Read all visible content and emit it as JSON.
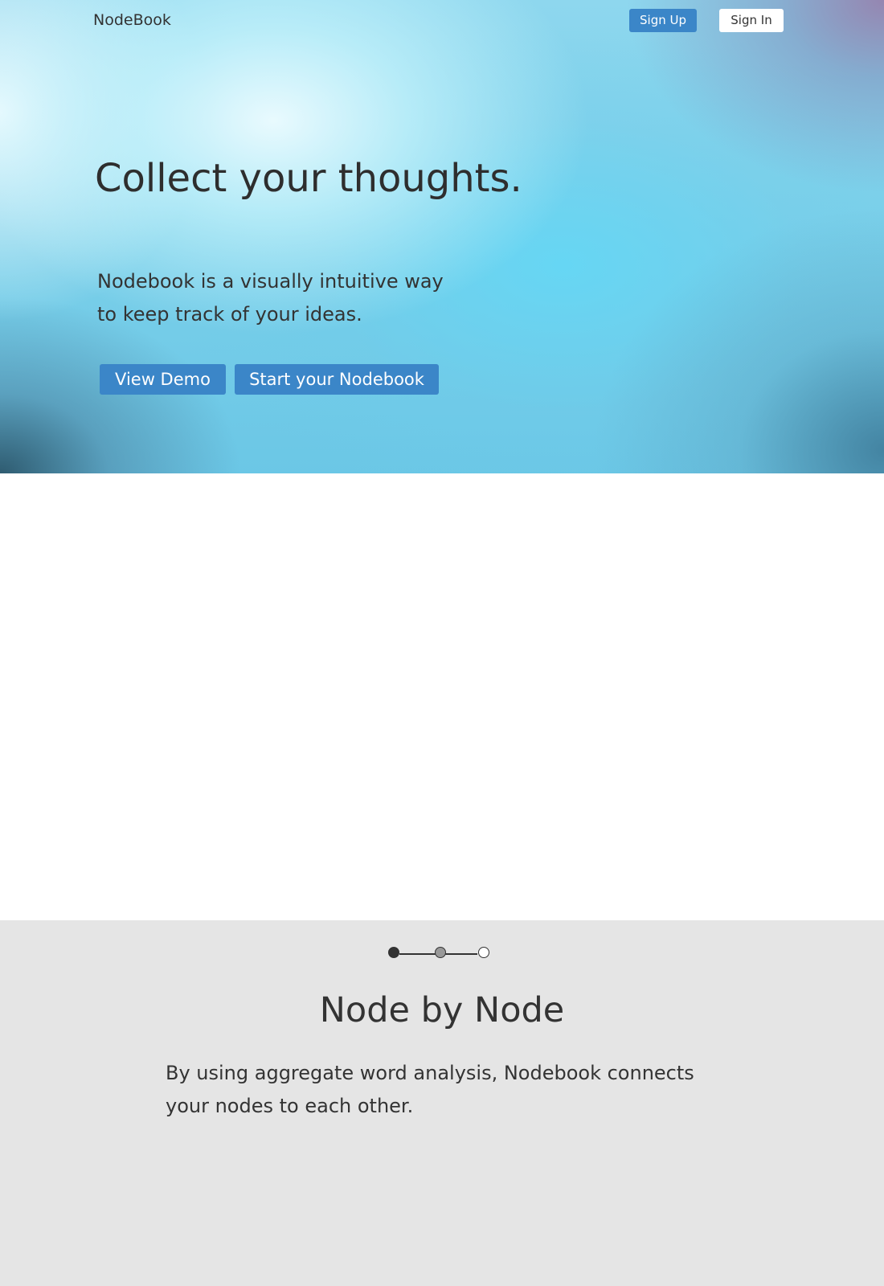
{
  "nav": {
    "brand": "NodeBook",
    "signup_label": "Sign Up",
    "signin_label": "Sign In"
  },
  "hero": {
    "headline": "Collect your thoughts.",
    "subtitle": "Nodebook is a visually intuitive way to keep track of your ideas.",
    "demo_button": "View Demo",
    "start_button": "Start your Nodebook"
  },
  "feature": {
    "progress": {
      "total_steps": 3,
      "current_step": 1
    },
    "title": "Node by Node",
    "text": "By using aggregate word analysis, Nodebook connects your nodes to each other."
  },
  "colors": {
    "accent": "#3b86c8",
    "text": "#333333",
    "feature_bg": "#e5e5e5",
    "step_active": "#333333",
    "step_next": "#999999",
    "step_empty": "#ffffff"
  }
}
